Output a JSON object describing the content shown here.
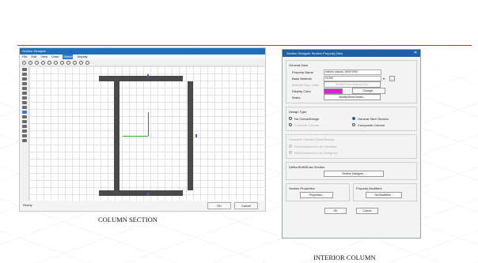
{
  "captions": {
    "left": "COLUMN SECTION",
    "right": "INTERIOR COLUMN"
  },
  "section_designer": {
    "title": "Section Designer",
    "menu": [
      "File",
      "Edit",
      "View",
      "Draw",
      "Select",
      "Display"
    ],
    "active_menu": "Select",
    "status": "Ready",
    "ok_label": "OK",
    "cancel_label": "Cancel"
  },
  "property_dialog": {
    "title": "Section Designer Section Property Data",
    "close_symbol": "✕",
    "general_group": "General Data",
    "property_name_label": "Property Name",
    "property_name_value": "Interior column 1000*1000",
    "base_material_label": "Base Material",
    "base_material_value": "Fe250",
    "material_dep_label": "Material Dep. Data",
    "material_dep_button": "Modify/Show Material Dep.",
    "display_color_label": "Display Color",
    "display_color_value": "#e020d8",
    "change_button": "Change...",
    "notes_label": "Notes",
    "notes_button": "Modify/Show Notes...",
    "design_type_group": "Design Type",
    "no_check_label": "No Check/Design",
    "general_steel_label": "General Steel Section",
    "concrete_label": "Concrete Column",
    "composite_label": "Composite Column",
    "concrete_check_group": "Concrete Column Check/Design",
    "reinf_checked_label": "Reinforcement to be Checked",
    "reinf_designed_label": "Reinforcement to be Designed",
    "define_group": "Define/Edit/Show Section",
    "section_designer_button": "Section Designer...",
    "section_props_group": "Section Properties",
    "properties_button": "Properties...",
    "prop_modifiers_group": "Property Modifiers",
    "set_modifiers_button": "Set Modifiers...",
    "ok_label": "OK",
    "cancel_label": "Cancel"
  }
}
